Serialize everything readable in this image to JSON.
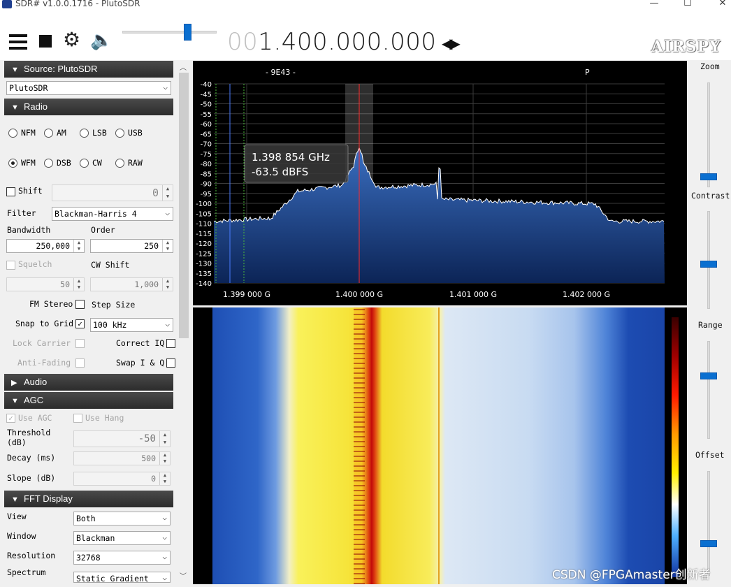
{
  "window": {
    "title": "SDR# v1.0.0.1716 - PlutoSDR",
    "minimize_glyph": "—",
    "maximize_glyph": "☐",
    "close_glyph": "✕"
  },
  "toolbar": {
    "menu_icon": "hamburger-menu-icon",
    "stop_icon": "stop-icon",
    "settings_icon": "gear-icon",
    "audio_icon": "speaker-icon",
    "volume_level": 0.7,
    "frequency_lead": "00",
    "frequency_main": "1.400.000.000",
    "tune_arrows": "◀▶",
    "logo_text": "AIRSPY"
  },
  "source": {
    "header": "Source: PlutoSDR",
    "device": "PlutoSDR"
  },
  "radio": {
    "header": "Radio",
    "modes": [
      "NFM",
      "AM",
      "LSB",
      "USB",
      "WFM",
      "DSB",
      "CW",
      "RAW"
    ],
    "selected_mode": "WFM",
    "shift_label": "Shift",
    "shift_value": "0",
    "filter_label": "Filter",
    "filter_value": "Blackman-Harris 4",
    "bandwidth_label": "Bandwidth",
    "bandwidth_value": "250,000",
    "order_label": "Order",
    "order_value": "250",
    "squelch_label": "Squelch",
    "squelch_value": "50",
    "cw_shift_label": "CW Shift",
    "cw_shift_value": "1,000",
    "fm_stereo_label": "FM Stereo",
    "step_size_label": "Step Size",
    "snap_to_grid_label": "Snap to Grid",
    "step_size_value": "100 kHz",
    "lock_carrier_label": "Lock Carrier",
    "correct_iq_label": "Correct IQ",
    "anti_fading_label": "Anti-Fading",
    "swap_iq_label": "Swap I & Q"
  },
  "audio": {
    "header": "Audio"
  },
  "agc": {
    "header": "AGC",
    "use_agc_label": "Use AGC",
    "use_hang_label": "Use Hang",
    "threshold_label_1": "Threshold",
    "threshold_label_2": "(dB)",
    "threshold_value": "-50",
    "decay_label": "Decay (ms)",
    "decay_value": "500",
    "slope_label": "Slope (dB)",
    "slope_value": "0"
  },
  "fft_display": {
    "header": "FFT Display",
    "view_label": "View",
    "view_value": "Both",
    "window_label": "Window",
    "window_value": "Blackman",
    "resolution_label": "Resolution",
    "resolution_value": "32768",
    "spectrum_style_label": "Spectrum",
    "spectrum_style_value": "Static Gradient"
  },
  "spectrum": {
    "top_left_label": "- 9E43 -",
    "top_right_label": "P",
    "y_ticks": [
      "-40",
      "-45",
      "-50",
      "-55",
      "-60",
      "-65",
      "-70",
      "-75",
      "-80",
      "-85",
      "-90",
      "-95",
      "-100",
      "-105",
      "-110",
      "-115",
      "-120",
      "-125",
      "-130",
      "-135",
      "-140"
    ],
    "x_ticks": [
      "1.399 000 G",
      "1.400 000 G",
      "1.401 000 G",
      "1.402 000 G"
    ],
    "tooltip_freq": "1.398 854 GHz",
    "tooltip_level": "-63.5 dBFS",
    "fill_color": "#1f4f9a",
    "line_color": "#ffffff"
  },
  "right_panel": {
    "zoom_label": "Zoom",
    "contrast_label": "Contrast",
    "range_label": "Range",
    "offset_label": "Offset",
    "accent": "#0a6fd0"
  },
  "watermark": "CSDN @FPGAmaster创新者"
}
